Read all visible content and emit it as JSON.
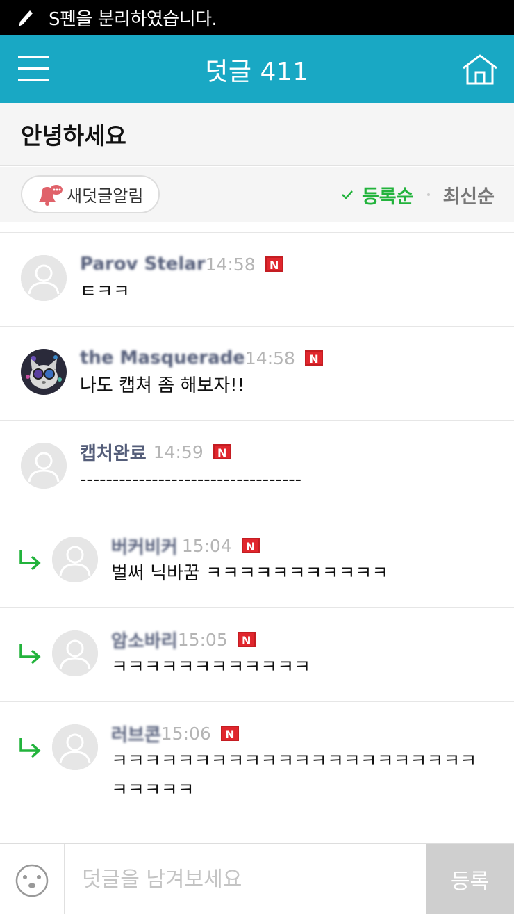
{
  "status_bar": {
    "text": "S펜을 분리하였습니다.",
    "icon": "pen-icon"
  },
  "header": {
    "title": "덧글 411",
    "menu_icon": "menu-icon",
    "home_icon": "home-icon"
  },
  "post": {
    "title": "안녕하세요"
  },
  "toolbar": {
    "alarm_label": "새덧글알림",
    "sort_active": "등록순",
    "sort_inactive": "최신순"
  },
  "comments": [
    {
      "nick": "Parov Stelar",
      "time": "14:58",
      "badge": "N",
      "text": "ㅌㅋㅋ",
      "reply": false,
      "avatar": "default"
    },
    {
      "nick": "the Masquerade",
      "time": "14:58",
      "badge": "N",
      "text": "나도 캡쳐 좀 해보자!!",
      "reply": false,
      "avatar": "cat-photo"
    },
    {
      "nick": "캡처완료",
      "time": "14:59",
      "badge": "N",
      "text": "----------------------------------",
      "reply": false,
      "avatar": "default"
    },
    {
      "nick": "버커비커",
      "time": "15:04",
      "badge": "N",
      "text": "벌써 닉바꿈 ㅋㅋㅋㅋㅋㅋㅋㅋㅋㅋㅋ",
      "reply": true,
      "avatar": "default"
    },
    {
      "nick": "암소바리",
      "time": "15:05",
      "badge": "N",
      "text": "ㅋㅋㅋㅋㅋㅋㅋㅋㅋㅋㅋㅋ",
      "reply": true,
      "avatar": "default"
    },
    {
      "nick": "러브콘",
      "time": "15:06",
      "badge": "N",
      "text": "ㅋㅋㅋㅋㅋㅋㅋㅋㅋㅋㅋㅋㅋㅋㅋㅋㅋㅋㅋㅋㅋㅋ",
      "text2": "ㅋㅋㅋㅋㅋ",
      "reply": true,
      "avatar": "default"
    }
  ],
  "input": {
    "placeholder": "덧글을 남겨보세요",
    "submit_label": "등록",
    "emoji_icon": "emoticon-icon"
  },
  "colors": {
    "header_bg": "#19a8c4",
    "accent_green": "#22b33c",
    "badge_red": "#e0262d"
  }
}
